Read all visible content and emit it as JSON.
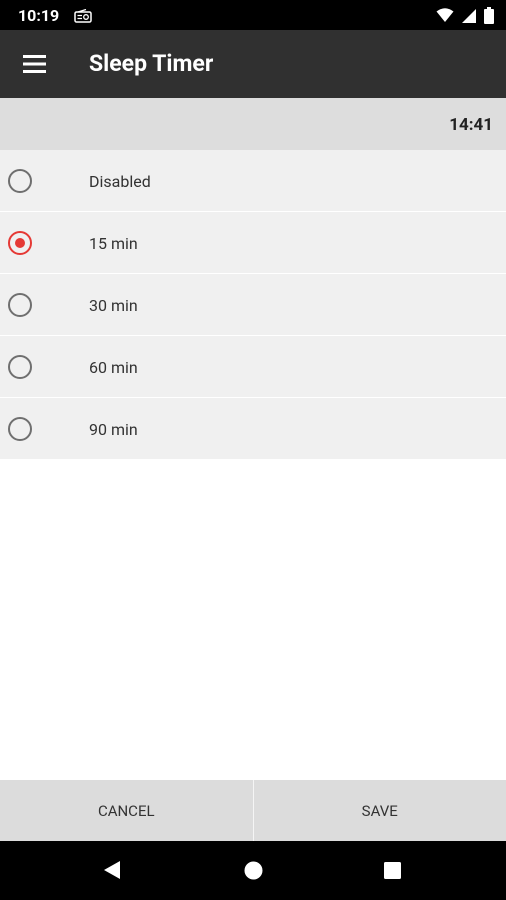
{
  "status_bar": {
    "time": "10:19",
    "icons": [
      "radio-icon",
      "wifi-icon",
      "signal-icon",
      "battery-icon"
    ]
  },
  "app_bar": {
    "title": "Sleep Timer",
    "menu_icon": "hamburger-menu-icon"
  },
  "clock": {
    "time": "14:41"
  },
  "options": [
    {
      "label": "Disabled",
      "selected": false
    },
    {
      "label": "15 min",
      "selected": true
    },
    {
      "label": "30 min",
      "selected": false
    },
    {
      "label": "60 min",
      "selected": false
    },
    {
      "label": "90 min",
      "selected": false
    }
  ],
  "buttons": {
    "cancel": "CANCEL",
    "save": "SAVE"
  },
  "colors": {
    "accent": "#e53935",
    "app_bar": "#303030",
    "list_bg": "#f0f0f0"
  }
}
